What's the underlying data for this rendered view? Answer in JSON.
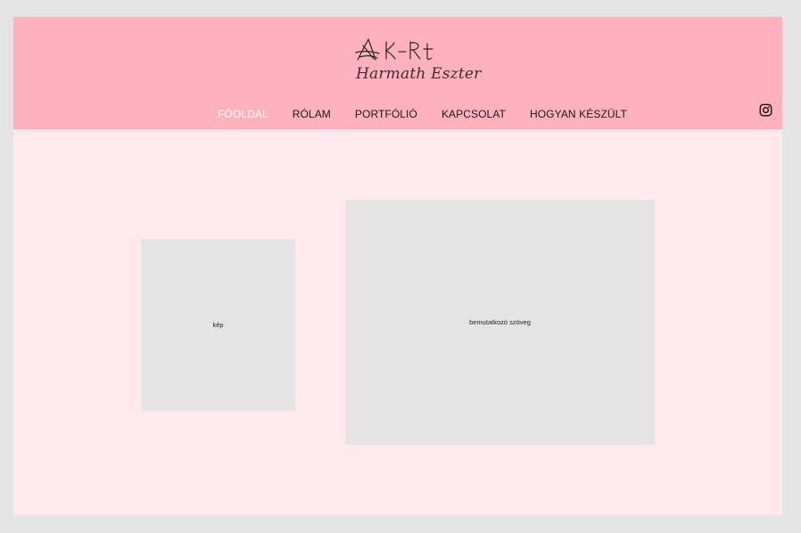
{
  "logo": {
    "mark": "AK-Rt",
    "subtitle": "Harmath Eszter"
  },
  "nav": {
    "items": [
      {
        "label": "FŐOLDAL",
        "active": true
      },
      {
        "label": "RÓLAM",
        "active": false
      },
      {
        "label": "PORTFÓLIÓ",
        "active": false
      },
      {
        "label": "KAPCSOLAT",
        "active": false
      },
      {
        "label": "HOGYAN KÉSZÜLT",
        "active": false
      }
    ]
  },
  "social": {
    "icon": "instagram-icon"
  },
  "content": {
    "image_placeholder": "kép",
    "text_placeholder": "bemutatkozó szöveg"
  },
  "colors": {
    "header_bg": "#ffb2bd",
    "page_bg": "#ffe9ed",
    "placeholder_bg": "#e4e4e4",
    "outer_bg": "#e4e4e4"
  }
}
